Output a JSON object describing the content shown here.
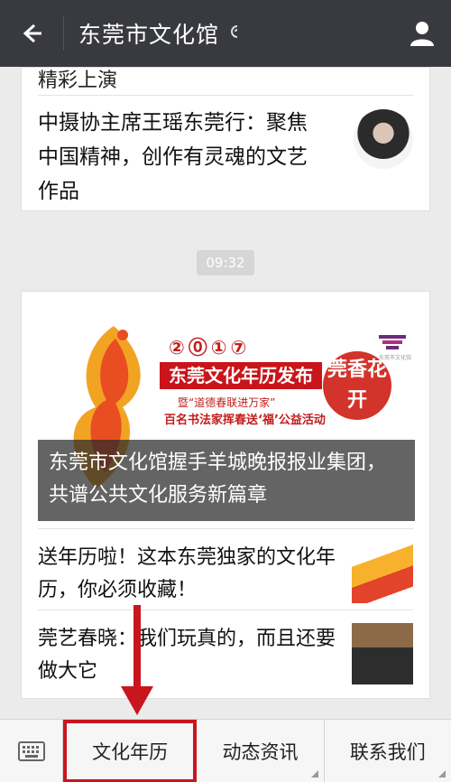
{
  "header": {
    "back_icon": "back-arrow-icon",
    "title": "东莞市文化馆",
    "title_badge_icon": "sound-wave-icon",
    "profile_icon": "user-icon"
  },
  "feed": {
    "card1": {
      "prev_title": "精彩上演",
      "article_title": "中摄协主席王瑶东莞行：聚焦中国精神，创作有灵魂的文艺作品"
    },
    "timestamp": "09:32",
    "card2": {
      "banner": {
        "year": "②⓪①⑦",
        "release": "东莞文化年历发布",
        "sub1": "暨“道德春联进万家”",
        "sub2": "百名书法家挥春送‘福’公益活动",
        "badge": "莞香花开",
        "logo_text": "东莞市文化馆"
      },
      "main_title": "东莞市文化馆握手羊城晚报报业集团，共谱公共文化服务新篇章",
      "items": [
        {
          "title": "送年历啦！这本东莞独家的文化年历，你必须收藏！"
        },
        {
          "title": "莞艺春晓：我们玩真的，而且还要做大它"
        }
      ]
    }
  },
  "bottom_menu": {
    "keyboard_icon": "keyboard-icon",
    "items": [
      {
        "label": "文化年历",
        "highlighted": true
      },
      {
        "label": "动态资讯"
      },
      {
        "label": "联系我们"
      }
    ]
  },
  "colors": {
    "topbar": "#393a3f",
    "highlight": "#c8161e"
  }
}
